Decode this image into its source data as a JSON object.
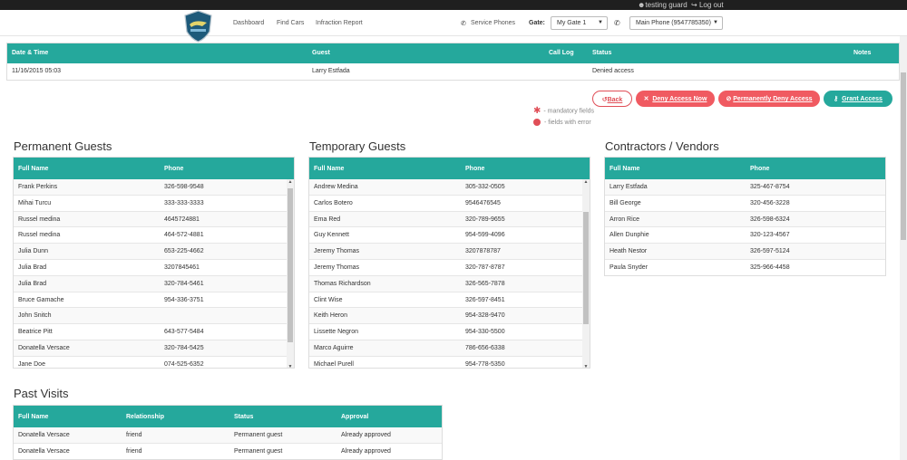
{
  "topbar": {
    "user": "testing guard",
    "logout": "Log out"
  },
  "nav": {
    "links": [
      "Dashboard",
      "Find Cars",
      "Infraction Report"
    ],
    "service_phones": "Service Phones",
    "gate_label": "Gate:",
    "gate_value": "My Gate 1",
    "phone_value": "Main Phone (9547785350)"
  },
  "visit": {
    "headers": {
      "datetime": "Date & Time",
      "guest": "Guest",
      "calllog": "Call Log",
      "status": "Status",
      "notes": "Notes"
    },
    "row": {
      "datetime": "11/16/2015 05:03",
      "guest": "Larry Estfada",
      "status": "Denied access"
    }
  },
  "actions": {
    "back": "Back",
    "deny": "Deny Access Now",
    "perm_deny": "Permanently Deny Access",
    "grant": "Grant Access"
  },
  "legend": {
    "mandatory": "- mandatory fields",
    "error": "- fields with error"
  },
  "permanent": {
    "title": "Permanent Guests",
    "h_name": "Full Name",
    "h_phone": "Phone",
    "rows": [
      [
        "Frank Perkins",
        "326-598-9548"
      ],
      [
        "Mihai Turcu",
        "333-333-3333"
      ],
      [
        "Russel medina",
        "4645724881"
      ],
      [
        "Russel medina",
        "464-572-4881"
      ],
      [
        "Julia Dunn",
        "653-225-4662"
      ],
      [
        "Julia Brad",
        "3207845461"
      ],
      [
        "Julia Brad",
        "320-784-5461"
      ],
      [
        "Bruce Gamache",
        "954-336-3751"
      ],
      [
        "John Snitch",
        ""
      ],
      [
        "Beatrice Pitt",
        "643-577-5484"
      ],
      [
        "Donatella Versace",
        "320-784-5425"
      ],
      [
        "Jane Doe",
        "074-525-6352"
      ]
    ]
  },
  "temporary": {
    "title": "Temporary Guests",
    "h_name": "Full Name",
    "h_phone": "Phone",
    "rows": [
      [
        "Andrew Medina",
        "305-332-0505"
      ],
      [
        "Carlos Botero",
        "9546476545"
      ],
      [
        "Ema Red",
        "320-789-9655"
      ],
      [
        "Guy Kennett",
        "954-599-4096"
      ],
      [
        "Jeremy Thomas",
        "3207878787"
      ],
      [
        "Jeremy Thomas",
        "320-787-8787"
      ],
      [
        "Thomas Richardson",
        "326-565-7878"
      ],
      [
        "Clint Wise",
        "326-597-8451"
      ],
      [
        "Keith Heron",
        "954-328-9470"
      ],
      [
        "Lissette Negron",
        "954-330-5500"
      ],
      [
        "Marco Aguirre",
        "786-656-6338"
      ],
      [
        "Michael Purell",
        "954-778-5350"
      ]
    ]
  },
  "contractors": {
    "title": "Contractors / Vendors",
    "h_name": "Full Name",
    "h_phone": "Phone",
    "rows": [
      [
        "Larry Estfada",
        "325-467-8754"
      ],
      [
        "Bill George",
        "320-456-3228"
      ],
      [
        "Arron Rice",
        "326-598-6324"
      ],
      [
        "Allen Dunphie",
        "320-123-4567"
      ],
      [
        "Heath Nestor",
        "326-597-5124"
      ],
      [
        "Paula Snyder",
        "325-966-4458"
      ]
    ]
  },
  "past": {
    "title": "Past Visits",
    "headers": {
      "name": "Full Name",
      "relationship": "Relationship",
      "status": "Status",
      "approval": "Approval"
    },
    "rows": [
      [
        "Donatella Versace",
        "friend",
        "Permanent guest",
        "Already approved"
      ],
      [
        "Donatella Versace",
        "friend",
        "Permanent guest",
        "Already approved"
      ]
    ]
  },
  "colors": {
    "accent": "#25a89c",
    "danger": "#f05a61",
    "topbar": "#1f1f1f"
  }
}
